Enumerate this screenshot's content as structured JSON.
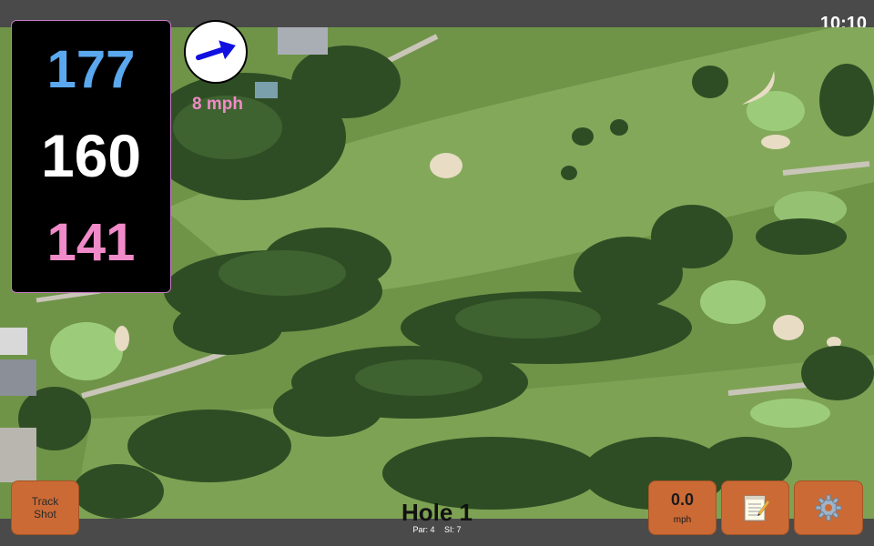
{
  "status_bar": {
    "time": "10:10"
  },
  "distances": {
    "back": "177",
    "middle": "160",
    "front": "141",
    "colors": {
      "back": "#5aa8ee",
      "middle": "#ffffff",
      "front": "#f08ac8"
    }
  },
  "wind": {
    "speed_label": "8 mph",
    "direction_icon": "arrow-right-icon",
    "color": "#f08ac8"
  },
  "buttons": {
    "track_shot_line1": "Track",
    "track_shot_line2": "Shot",
    "speed_value": "0.0",
    "speed_unit": "mph",
    "notes_icon": "notepad-icon",
    "settings_icon": "gear-icon",
    "accent": "#cc6a35"
  },
  "hole": {
    "title": "Hole 1",
    "par": "Par: 4",
    "stroke_index": "SI: 7"
  }
}
